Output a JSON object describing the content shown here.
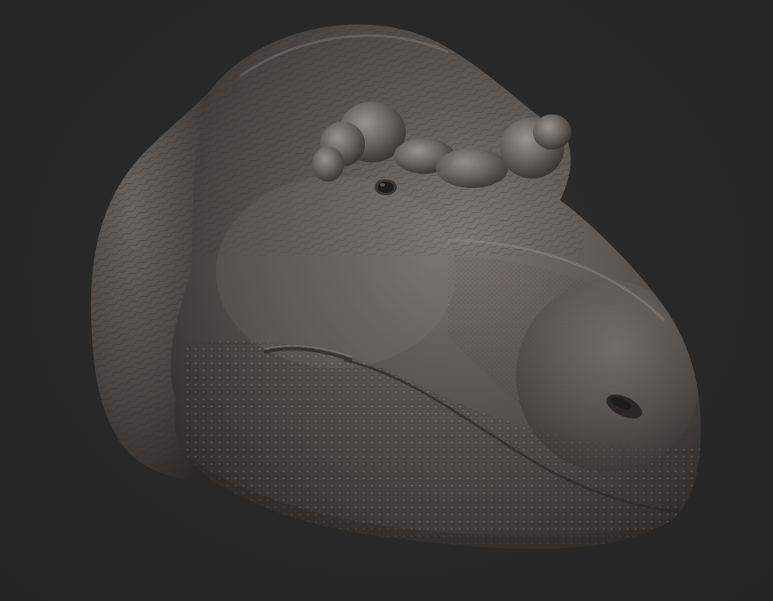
{
  "scene": {
    "background_color": "#282828",
    "clay_color": "#5a5552",
    "clay_highlight": "#8a8480",
    "clay_shadow": "#2e2b29",
    "subject": "sculpted-dinosaur-head"
  }
}
